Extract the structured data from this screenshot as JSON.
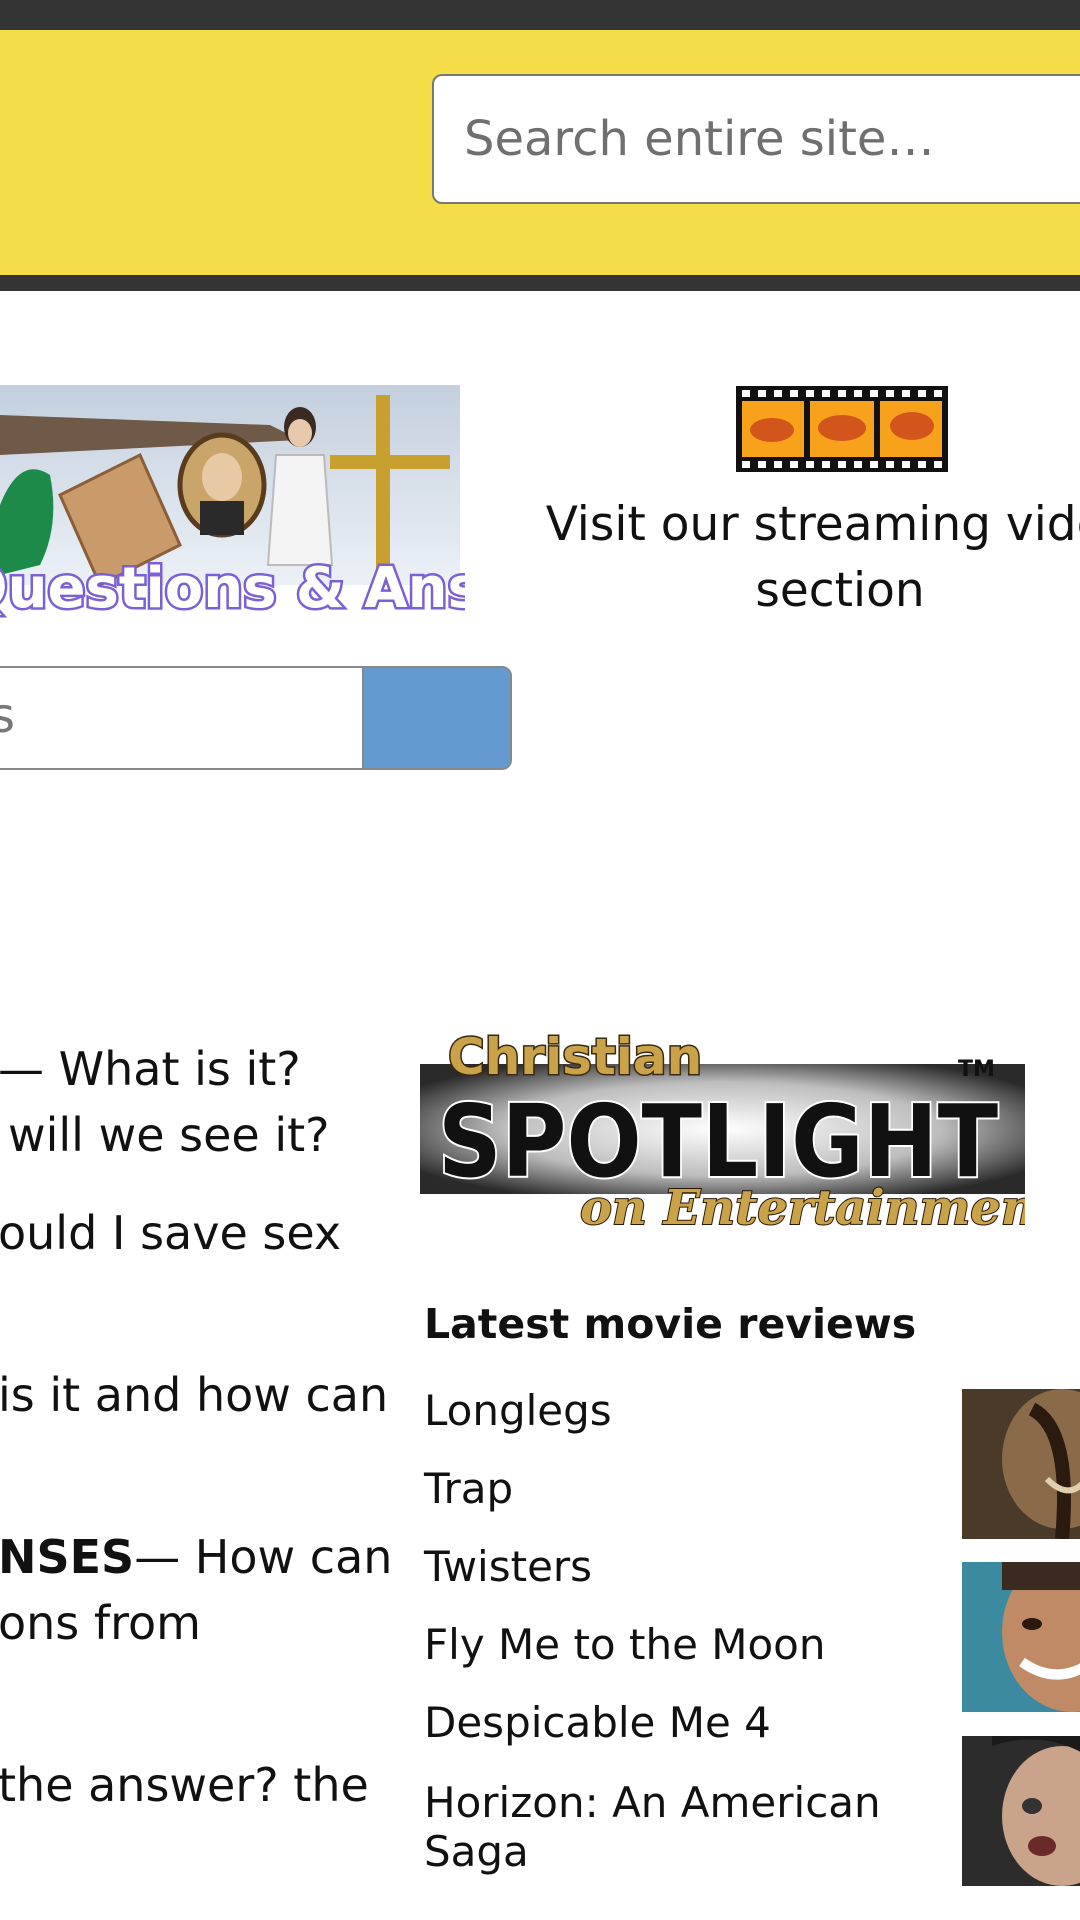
{
  "header": {
    "search_placeholder": "Search entire site…"
  },
  "qa": {
    "logo_text": "Questions & Answers",
    "input_partial_text": "s"
  },
  "video": {
    "visit_line1": "Visit our streaming video",
    "visit_line2": "section"
  },
  "articles": {
    "lines": [
      "— What is it?",
      "will we see it?",
      "ould I save sex",
      "is it and how can",
      "— How can",
      "ons from",
      "the answer? the"
    ],
    "bold_fragment": "NSES"
  },
  "spotlight": {
    "logo_top": "Christian",
    "logo_main": "SPOTLIGHT",
    "logo_tm": "TM",
    "logo_bottom": "on Entertainment"
  },
  "reviews": {
    "heading": "Latest movie reviews",
    "items": [
      "Longlegs",
      "Trap",
      "Twisters",
      "Fly Me to the Moon",
      "Despicable Me 4",
      "Horizon: An American",
      "Saga"
    ]
  },
  "colors": {
    "header_yellow": "#f5dd47",
    "bar_dark": "#343434",
    "search_button_blue": "#659ad0"
  }
}
